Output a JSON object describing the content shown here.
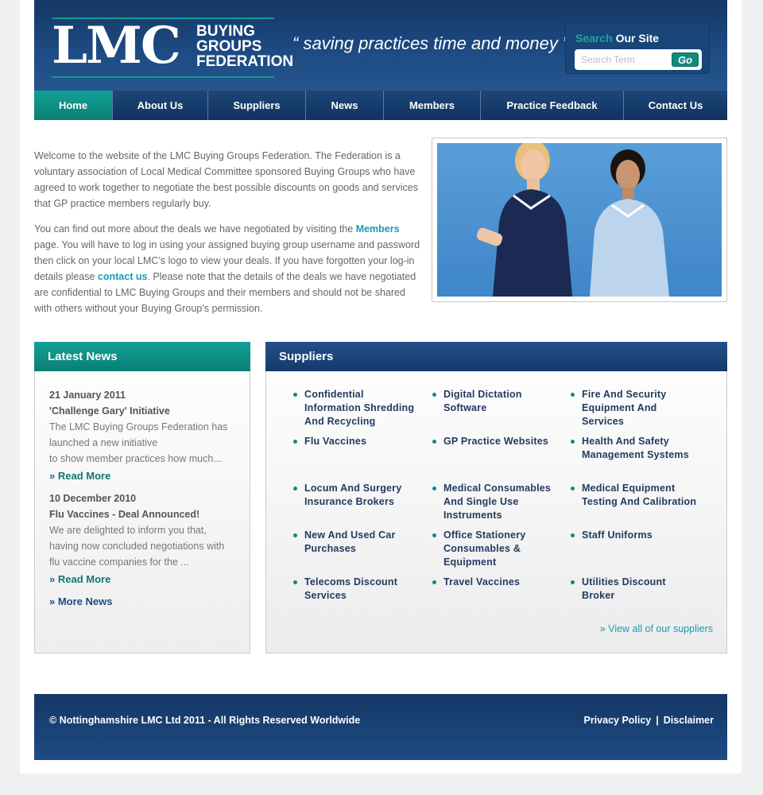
{
  "header": {
    "logo_letters": "LMC",
    "logo_words": [
      "BUYING",
      "GROUPS",
      "FEDERATION"
    ],
    "tagline": "“ saving practices time and money ”",
    "search": {
      "title_accent": "Search",
      "title_rest": " Our Site",
      "placeholder": "Search Term",
      "go_label": "Go"
    }
  },
  "nav": {
    "items": [
      {
        "label": "Home",
        "active": true
      },
      {
        "label": "About Us"
      },
      {
        "label": "Suppliers"
      },
      {
        "label": "News"
      },
      {
        "label": "Members"
      },
      {
        "label": "Practice Feedback"
      },
      {
        "label": "Contact Us"
      }
    ]
  },
  "intro": {
    "p1": "Welcome to the website of the LMC Buying Groups Federation. The Federation is a voluntary association of Local Medical Committee sponsored Buying Groups who have agreed to work together to negotiate the best possible discounts on goods and services that GP practice members regularly buy.",
    "p2_a": "You can find out more about the deals we have negotiated by visiting the ",
    "p2_link1": "Members",
    "p2_b": " page. You will have to log in using your assigned buying group username and password then click on your local LMC’s logo to view your deals. If you have forgotten your log-in details please ",
    "p2_link2": "contact us",
    "p2_c": ". Please note that the details of the deals we have negotiated are confidential to LMC Buying Groups and their members and should not be shared with others without your Buying Group’s permission."
  },
  "news": {
    "heading": "Latest News",
    "items": [
      {
        "date": "21 January 2011",
        "title": "'Challenge Gary' Initiative",
        "excerpt1": "The LMC Buying Groups Federation has launched a new initiative",
        "excerpt2": "to show member practices how much...",
        "read_more": "» Read More"
      },
      {
        "date": "10 December 2010",
        "title": "Flu Vaccines - Deal Announced!",
        "excerpt1": "We are delighted to inform you that, having now concluded negotiations with flu vaccine companies for the ...",
        "excerpt2": "",
        "read_more": "» Read More"
      }
    ],
    "more_news": "» More News"
  },
  "suppliers": {
    "heading": "Suppliers",
    "items": [
      "Confidential Information Shredding And Recycling",
      "Digital Dictation Software",
      "Fire And Security Equipment And Services",
      "Flu Vaccines",
      "GP Practice Websites",
      "Health And Safety Management Systems",
      "Locum And Surgery Insurance Brokers",
      "Medical Consumables And Single Use Instruments",
      "Medical Equipment Testing And Calibration",
      "New And Used Car Purchases",
      "Office Stationery Consumables & Equipment",
      "Staff Uniforms",
      "Telecoms Discount Services",
      "Travel Vaccines",
      "Utilities Discount Broker"
    ],
    "view_all": "» View all of our suppliers"
  },
  "footer": {
    "copyright": "© Nottinghamshire LMC Ltd 2011 - All Rights Reserved Worldwide",
    "privacy": "Privacy Policy",
    "separator": "|",
    "disclaimer": "Disclaimer"
  },
  "colors": {
    "navy": "#143765",
    "teal": "#11a195",
    "link": "#1a9cb0"
  }
}
